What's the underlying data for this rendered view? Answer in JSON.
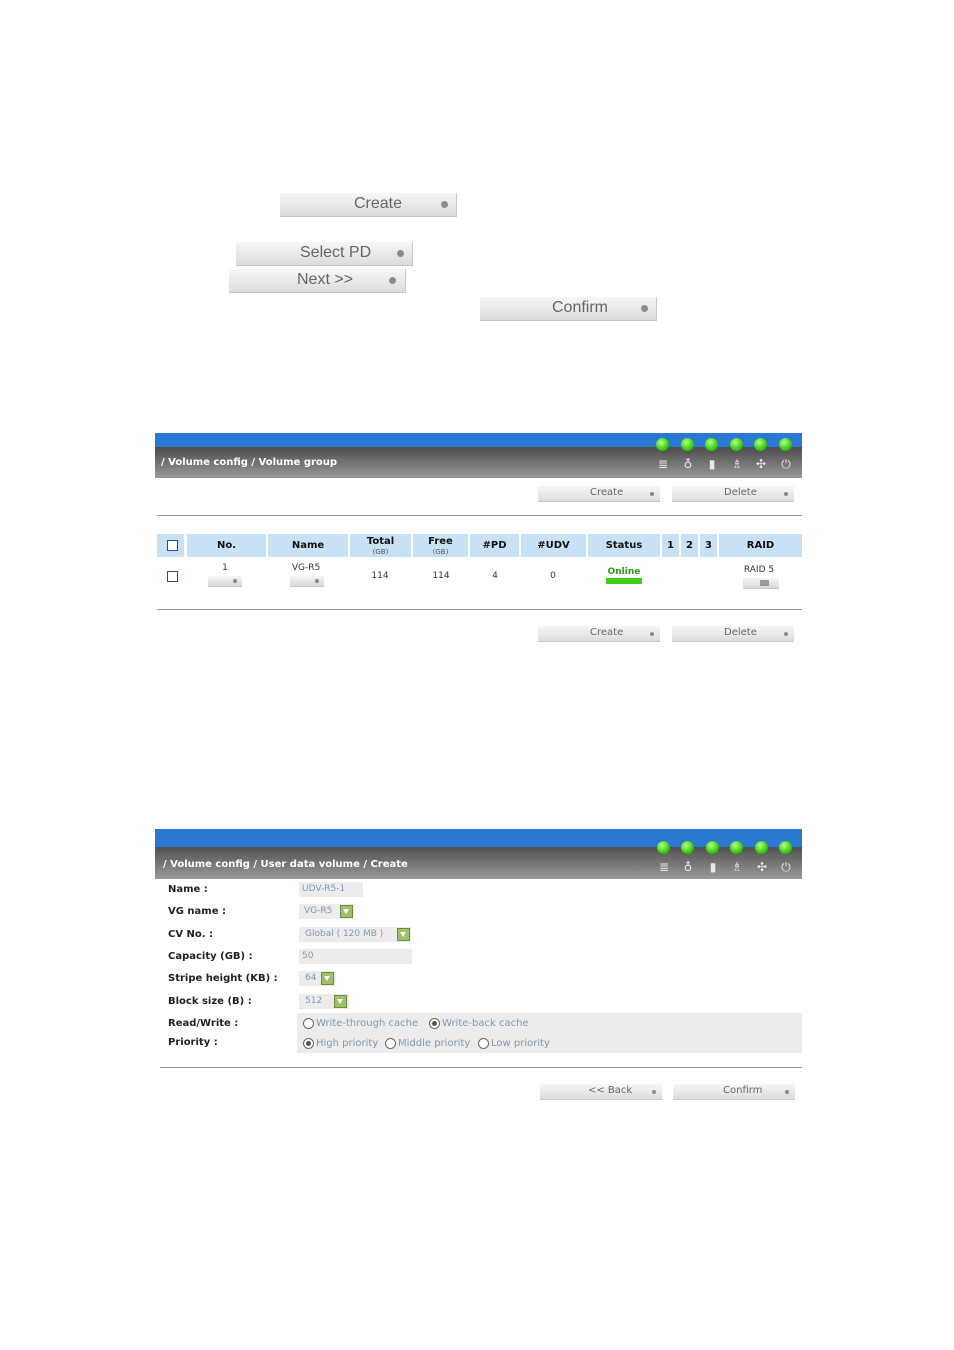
{
  "standalone_buttons": {
    "create": "Create",
    "select_pd": "Select PD",
    "next": "Next >>",
    "confirm": "Confirm"
  },
  "panel1": {
    "breadcrumb": "/ Volume config / Volume group",
    "create": "Create",
    "delete": "Delete",
    "columns": {
      "no": "No.",
      "name": "Name",
      "total": "Total",
      "total_unit": "(GB)",
      "free": "Free",
      "free_unit": "(GB)",
      "pd": "#PD",
      "udv": "#UDV",
      "status": "Status",
      "c1": "1",
      "c2": "2",
      "c3": "3",
      "raid": "RAID"
    },
    "row": {
      "no": "1",
      "name": "VG-R5",
      "total": "114",
      "free": "114",
      "pd": "4",
      "udv": "0",
      "status": "Online",
      "raid": "RAID 5"
    },
    "status_color": "#3fcf14"
  },
  "panel2": {
    "breadcrumb": "/ Volume config / User data volume / Create",
    "labels": {
      "name": "Name :",
      "vg_name": "VG name :",
      "cv_no": "CV No. :",
      "capacity": "Capacity (GB) :",
      "stripe": "Stripe height (KB) :",
      "block": "Block size (B) :",
      "read_write": "Read/Write :",
      "priority": "Priority :"
    },
    "values": {
      "name": "UDV-R5-1",
      "vg_name": "VG-R5",
      "cv_no": "Global ( 120 MB )",
      "capacity": "50",
      "stripe": "64",
      "block": "512"
    },
    "read_write_options": [
      "Write-through cache",
      "Write-back cache"
    ],
    "read_write_selected": "Write-back cache",
    "priority_options": [
      "High priority",
      "Middle priority",
      "Low priority"
    ],
    "priority_selected": "High priority",
    "back": "<< Back",
    "confirm": "Confirm"
  },
  "header_icons": [
    "disk-icon",
    "temperature-icon",
    "battery-icon",
    "voltage-icon",
    "fan-icon",
    "power-icon"
  ],
  "colors": {
    "header_blue": "#2a78d2",
    "led_green": "#3fcf14",
    "table_header": "#c9e1f5"
  }
}
